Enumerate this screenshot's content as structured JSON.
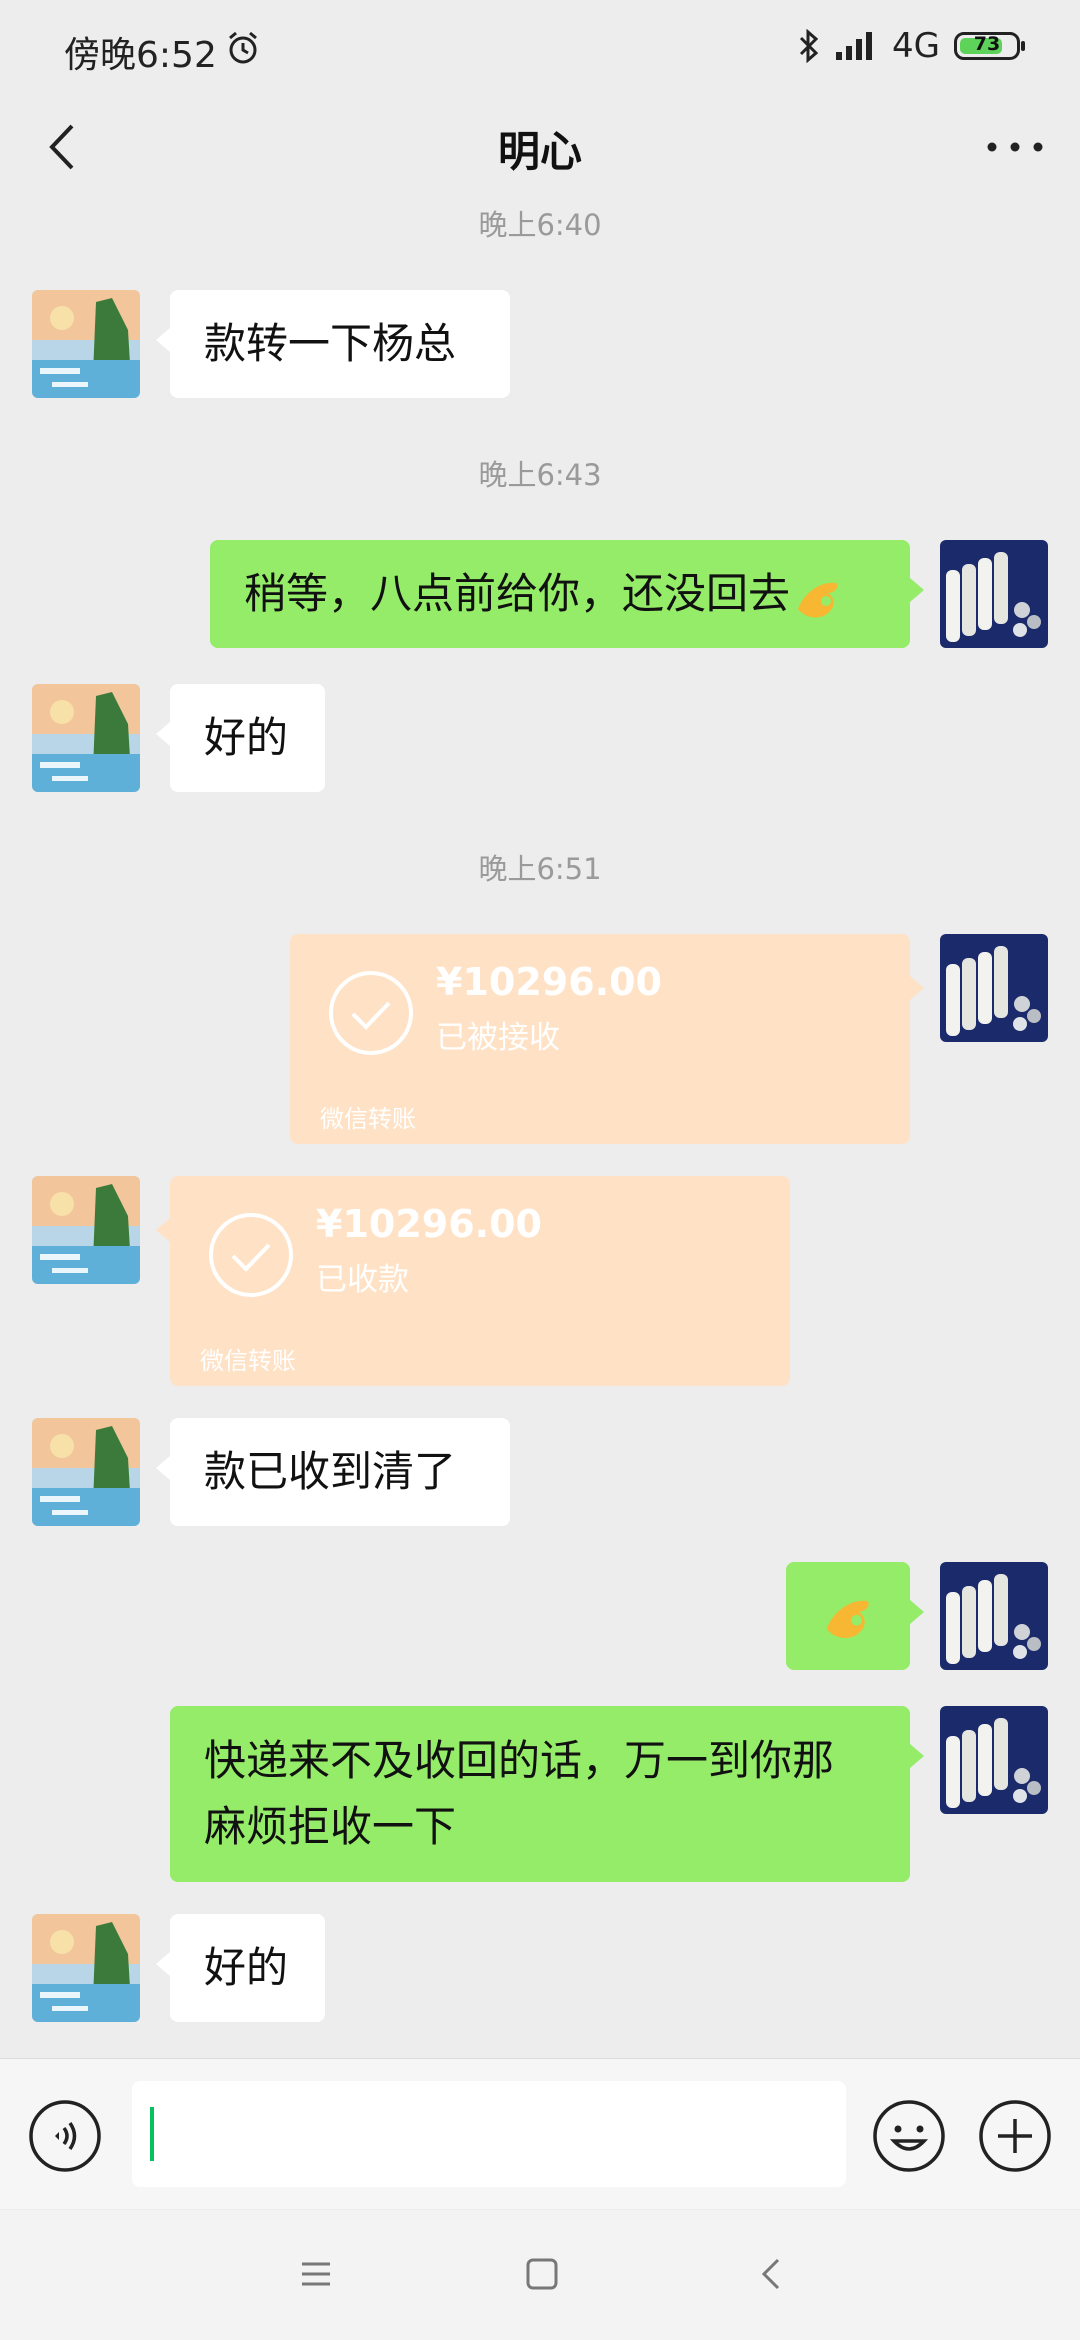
{
  "status_bar": {
    "time": "傍晚6:52",
    "network": "4G",
    "battery": "73",
    "icons": [
      "alarm-icon",
      "bluetooth-icon",
      "signal-icon",
      "battery-icon"
    ]
  },
  "header": {
    "title": "明心",
    "icons": [
      "back-icon",
      "more-icon"
    ]
  },
  "messages": {
    "time_1": "晚上6:40",
    "msg_1": "款转一下杨总",
    "time_2": "晚上6:43",
    "msg_2": "稍等，八点前给你，还没回去",
    "msg_3": "好的",
    "time_3": "晚上6:51",
    "transfer_1": {
      "amount": "¥10296.00",
      "status": "已被接收",
      "footer": "微信转账"
    },
    "transfer_2": {
      "amount": "¥10296.00",
      "status": "已收款",
      "footer": "微信转账"
    },
    "msg_4": "款已收到清了",
    "msg_6_line1": "快递来不及收回的话，万一到你那",
    "msg_6_line2": "麻烦拒收一下",
    "msg_7": "好的",
    "emoji_icons": [
      "ok-hand-emoji-icon",
      "ok-hand-emoji-icon"
    ]
  },
  "input_bar": {
    "icons": [
      "voice-icon",
      "emoji-icon",
      "plus-icon"
    ]
  },
  "nav_bar": {
    "icons": [
      "menu-icon",
      "home-icon",
      "back-icon"
    ]
  },
  "colors": {
    "background": "#ededed",
    "sent_bubble": "#95ec69",
    "received_bubble": "#ffffff",
    "transfer_bubble": "#ffe2c6",
    "caret": "#07c160"
  }
}
